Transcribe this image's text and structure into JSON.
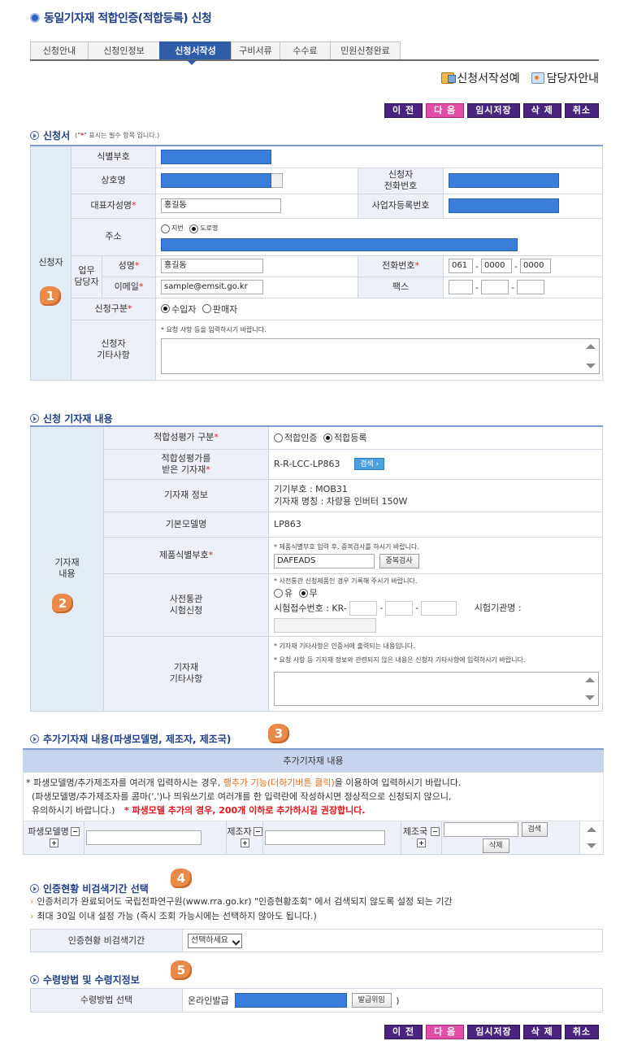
{
  "page": {
    "title": "동일기자재 적합인증(적합등록) 신청"
  },
  "tabs": [
    {
      "label": "신청안내",
      "active": false
    },
    {
      "label": "신청인정보",
      "active": false
    },
    {
      "label": "신청서작성",
      "active": true
    },
    {
      "label": "구비서류",
      "active": false
    },
    {
      "label": "수수료",
      "active": false
    },
    {
      "label": "민원신청완료",
      "active": false
    }
  ],
  "help_links": {
    "example": "신청서작성예",
    "contact": "담당자안내"
  },
  "actions": {
    "prev": "이 전",
    "next": "다 음",
    "save": "임시저장",
    "delete": "삭 제",
    "cancel": "취소"
  },
  "applicant": {
    "section_title": "신청서",
    "required_note_prefix": "(\"",
    "required_note_star": "*",
    "required_note_suffix": "\" 표시는 필수 항목 입니다.)",
    "group_label": "신청자",
    "badge": "1",
    "id_number_label": "식별부호",
    "company_label": "상호명",
    "phone_label_1": "신청자",
    "phone_label_2": "전화번호",
    "rep_label": "대표자성명",
    "rep_value": "홍길동",
    "bizno_label": "사업자등록번호",
    "address_label": "주소",
    "addr_jibun": "지번",
    "addr_road": "도로명",
    "contact_label_1": "업무",
    "contact_label_2": "담당자",
    "name_label": "성명",
    "name_value": "홍길동",
    "tel_label": "전화번호",
    "tel_1": "061",
    "tel_2": "0000",
    "tel_3": "0000",
    "email_label": "이메일",
    "email_value": "sample@emsit.go.kr",
    "fax_label": "팩스",
    "type_label": "신청구분",
    "type_importer": "수입자",
    "type_seller": "판매자",
    "memo_label_1": "신청자",
    "memo_label_2": "기타사항",
    "memo_hint": "* 요청 사항 등을 입력하시기 바랍니다."
  },
  "equipment": {
    "section_title": "신청 기자재 내용",
    "group_label_1": "기자재",
    "group_label_2": "내용",
    "badge": "2",
    "eval_type_label": "적합성평가 구분",
    "eval_cert": "적합인증",
    "eval_reg": "적합등록",
    "base_equip_label_1": "적합성평가를",
    "base_equip_label_2": "받은 기자재",
    "base_equip_value": "R-R-LCC-LP863",
    "search_btn": "검색",
    "info_label": "기자재 정보",
    "info_line_1": "기기부호 : MOB31",
    "info_line_2": "기자재 명칭 : 차량용 인버터 150W",
    "base_model_label": "기본모델명",
    "base_model_value": "LP863",
    "product_id_label": "제품식별부호",
    "product_id_hint": "* 제품식별부호 입력 후, 중복검사를 하시기 바랍니다.",
    "product_id_value": "DAFEADS",
    "dup_check_btn": "중복검사",
    "customs_label_1": "사전통관",
    "customs_label_2": "시험신청",
    "customs_hint": "* 사전통관 신청제품인 경우 기록해 주시기 바랍니다.",
    "customs_yes": "유",
    "customs_no": "무",
    "test_no_label": "시험접수번호 : KR-",
    "lab_label": "시험기관명 :",
    "memo_label_1": "기자재",
    "memo_label_2": "기타사항",
    "memo_hint_1": "* 기자재 기타사항은 인증서에 출력되는 내용입니다.",
    "memo_hint_2": "* 요청 사항 등 기자재 정보와 관련되지 않은 내용은 신청자 기타사항에 입력하시기 바랍니다."
  },
  "extra": {
    "section_title": "추가기자재 내용(파생모델명, 제조자, 제조국)",
    "badge": "3",
    "table_header": "추가기자재 내용",
    "note_1_prefix": "* 파생모델명/추가제조자를 여러개 입력하시는 경우, ",
    "note_1_highlight": "행추가 기능(더하기버튼 클릭)",
    "note_1_suffix": "을 이용하여 입력하시기 바랍니다.",
    "note_2": "(파생모델명/추가제조자를 콤마(',')나 띄워쓰기로 여러개를 한 입력란에 작성하시면 정상적으로 신청되지 않으니,",
    "note_3": "유의하시기 바랍니다.)",
    "note_3_red": "* 파생모델 추가의 경우, 200개 이하로 추가하시길 권장합니다.",
    "model_label": "파생모델명",
    "maker_label": "제조자",
    "country_label": "제조국",
    "search_btn": "검색",
    "delete_btn": "삭제"
  },
  "privacy": {
    "section_title": "인증현황 비검색기간 선택",
    "badge": "4",
    "line_1": "인증처리가 완료되어도 국립전파연구원(www.rra.go.kr) \"인증현황조회\" 에서 검색되지 않도록 설정 되는 기간",
    "line_2": "최대 30일 이내 설정 가능 (즉시 조회 가능시에는 선택하지 않아도 됩니다.)",
    "period_label": "인증현황 비검색기간",
    "period_value": "선택하세요"
  },
  "receive": {
    "section_title": "수령방법 및 수령지정보",
    "badge": "5",
    "method_label": "수령방법 선택",
    "method_value": "온라인발급",
    "issue_btn": "발급위임",
    "closing": ")"
  }
}
